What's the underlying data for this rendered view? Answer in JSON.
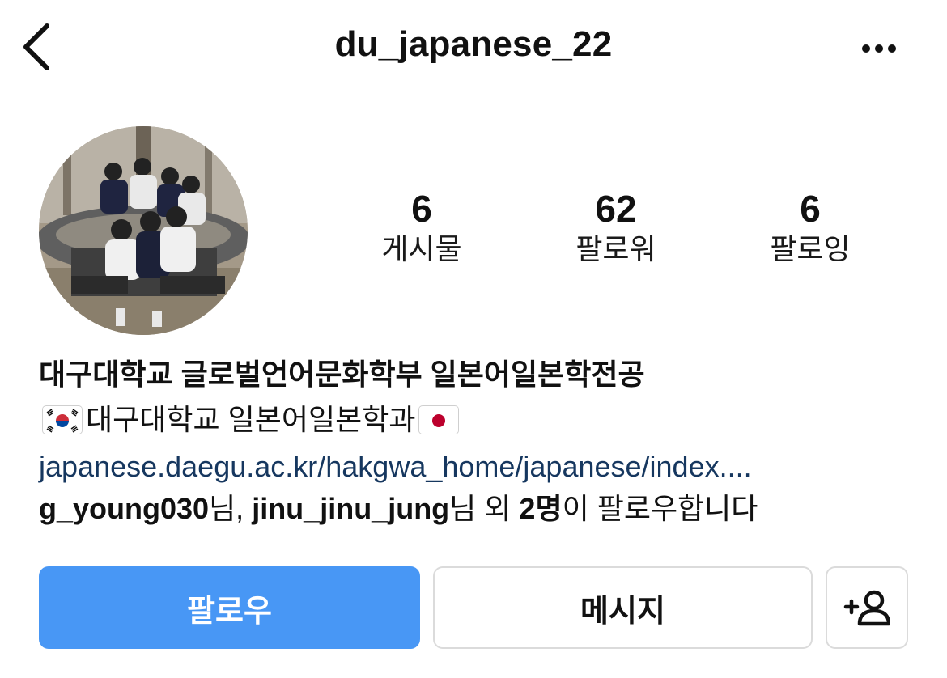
{
  "header": {
    "username": "du_japanese_22",
    "back_icon": "chevron-left-icon",
    "more_icon": "more-horizontal-icon"
  },
  "stats": {
    "posts": {
      "value": "6",
      "label": "게시물"
    },
    "followers": {
      "value": "62",
      "label": "팔로워"
    },
    "following": {
      "value": "6",
      "label": "팔로잉"
    }
  },
  "bio": {
    "name": "대구대학교 글로벌언어문화학부 일본어일본학전공",
    "description": "대구대학교 일본어일본학과",
    "link": "japanese.daegu.ac.kr/hakgwa_home/japanese/index....",
    "followed_by": {
      "user1": "g_young030",
      "suffix1": "님, ",
      "user2": "jinu_jinu_jung",
      "suffix2": "님 외 ",
      "others": "2명",
      "suffix3": "이 팔로우합니다"
    }
  },
  "actions": {
    "follow_label": "팔로우",
    "message_label": "메시지",
    "suggest_icon": "add-person-icon"
  },
  "colors": {
    "follow_button": "#4897f5",
    "link": "#16375f",
    "border": "#dbdbdb"
  }
}
